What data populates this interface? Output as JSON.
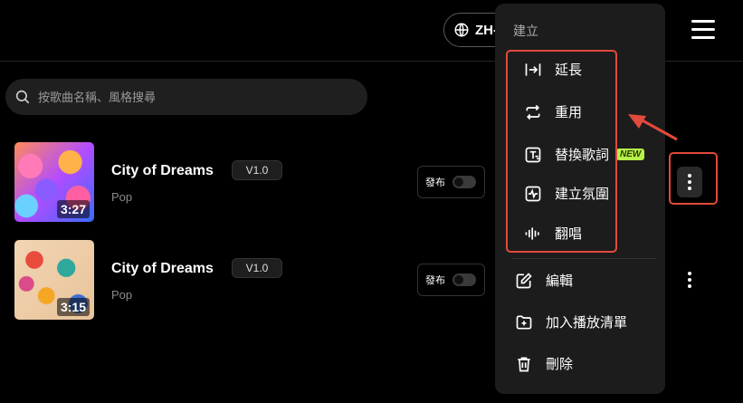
{
  "header": {
    "language_label": "ZH-"
  },
  "search": {
    "placeholder": "按歌曲名稱、風格搜尋"
  },
  "songs": [
    {
      "title": "City of Dreams",
      "version": "V1.0",
      "genre": "Pop",
      "duration": "3:27",
      "publish_label": "發布"
    },
    {
      "title": "City of Dreams",
      "version": "V1.0",
      "genre": "Pop",
      "duration": "3:15",
      "publish_label": "發布"
    }
  ],
  "menu": {
    "header": "建立",
    "create_items": [
      {
        "label": "延長",
        "icon": "extend-icon"
      },
      {
        "label": "重用",
        "icon": "reuse-icon"
      },
      {
        "label": "替換歌詞",
        "icon": "replace-lyrics-icon",
        "badge": "NEW"
      },
      {
        "label": "建立氛圍",
        "icon": "create-vibe-icon"
      },
      {
        "label": "翻唱",
        "icon": "cover-icon"
      }
    ],
    "other_items": [
      {
        "label": "編輯",
        "icon": "edit-icon"
      },
      {
        "label": "加入播放清單",
        "icon": "add-playlist-icon"
      },
      {
        "label": "刪除",
        "icon": "trash-icon"
      }
    ]
  },
  "colors": {
    "highlight": "#e24a3b",
    "new_badge": "#b6f24a",
    "menu_bg": "#1c1c1c"
  }
}
